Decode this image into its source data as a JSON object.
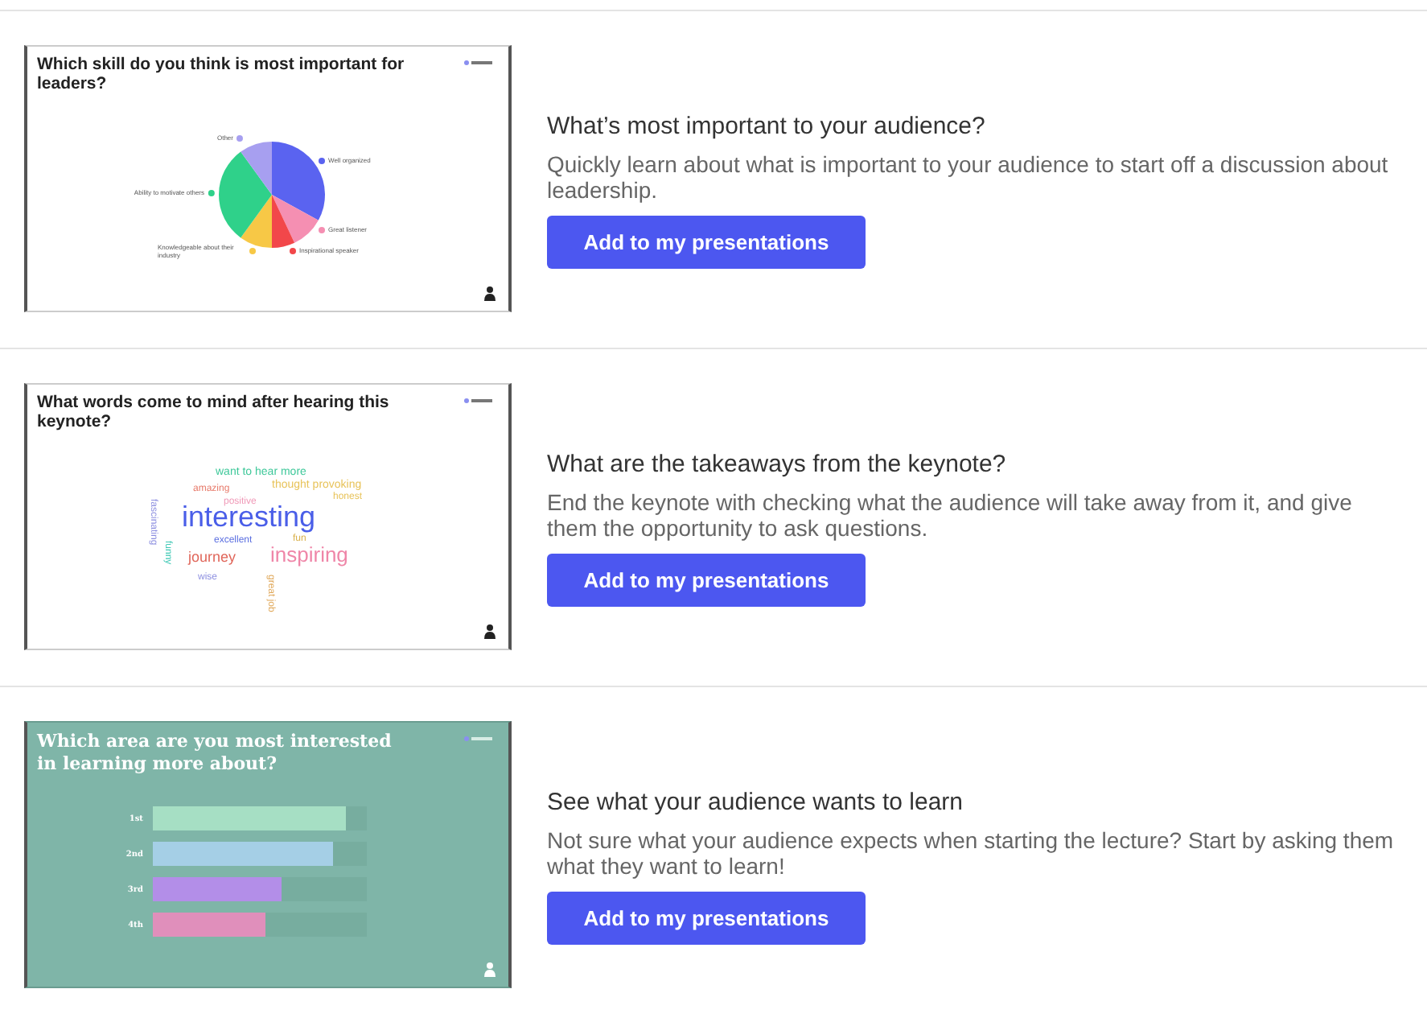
{
  "templates": [
    {
      "kind": "pie",
      "slide": {
        "title": "Which skill do you think is most important for leaders?",
        "legend": [
          {
            "label": "Other",
            "color": "#a79ff0"
          },
          {
            "label": "Well organized",
            "color": "#5a63f0"
          },
          {
            "label": "Ability to motivate others",
            "color": "#2fd18a"
          },
          {
            "label": "Great listener",
            "color": "#f58fb2"
          },
          {
            "label": "Knowledgeable about their industry",
            "color": "#f7c846"
          },
          {
            "label": "Inspirational speaker",
            "color": "#f2474a"
          }
        ]
      },
      "heading": "What’s most important to your audience?",
      "description": "Quickly learn about what is important to your audience to start off a discussion about leadership.",
      "button": "Add to my presentations"
    },
    {
      "kind": "cloud",
      "slide": {
        "title": "What words come to mind after hearing this keynote?",
        "words": [
          {
            "text": "want to hear more",
            "color": "#3fc89a"
          },
          {
            "text": "amazing",
            "color": "#e77a6a"
          },
          {
            "text": "thought provoking",
            "color": "#e8c35a"
          },
          {
            "text": "positive",
            "color": "#f09ab8"
          },
          {
            "text": "honest",
            "color": "#e8c35a"
          },
          {
            "text": "fascinating",
            "color": "#8d8fe0"
          },
          {
            "text": "interesting",
            "color": "#4a5ee8"
          },
          {
            "text": "excellent",
            "color": "#5a6ee0"
          },
          {
            "text": "fun",
            "color": "#d9b04a"
          },
          {
            "text": "funny",
            "color": "#3fc8b5"
          },
          {
            "text": "journey",
            "color": "#e0665a"
          },
          {
            "text": "inspiring",
            "color": "#ef86a8"
          },
          {
            "text": "wise",
            "color": "#8d8fe0"
          },
          {
            "text": "great job",
            "color": "#e0a85a"
          }
        ]
      },
      "heading": "What are the takeaways from the keynote?",
      "description": "End the keynote with checking what the audience will take away from it, and give them the opportunity to ask questions.",
      "button": "Add to my presentations"
    },
    {
      "kind": "ranking",
      "slide": {
        "title": "Which area are you most interested in learning more about?",
        "ranks": [
          {
            "label": "1st",
            "level": 0.9,
            "color": "#a6dfc4"
          },
          {
            "label": "2nd",
            "level": 0.84,
            "color": "#a5cfe6"
          },
          {
            "label": "3rd",
            "level": 0.6,
            "color": "#b38ee8"
          },
          {
            "label": "4th",
            "level": 0.53,
            "color": "#e08fbb"
          }
        ]
      },
      "heading": "See what your audience wants to learn",
      "description": "Not sure what your audience expects when starting the lecture? Start by asking them what they want to learn!",
      "button": "Add to my presentations"
    }
  ]
}
